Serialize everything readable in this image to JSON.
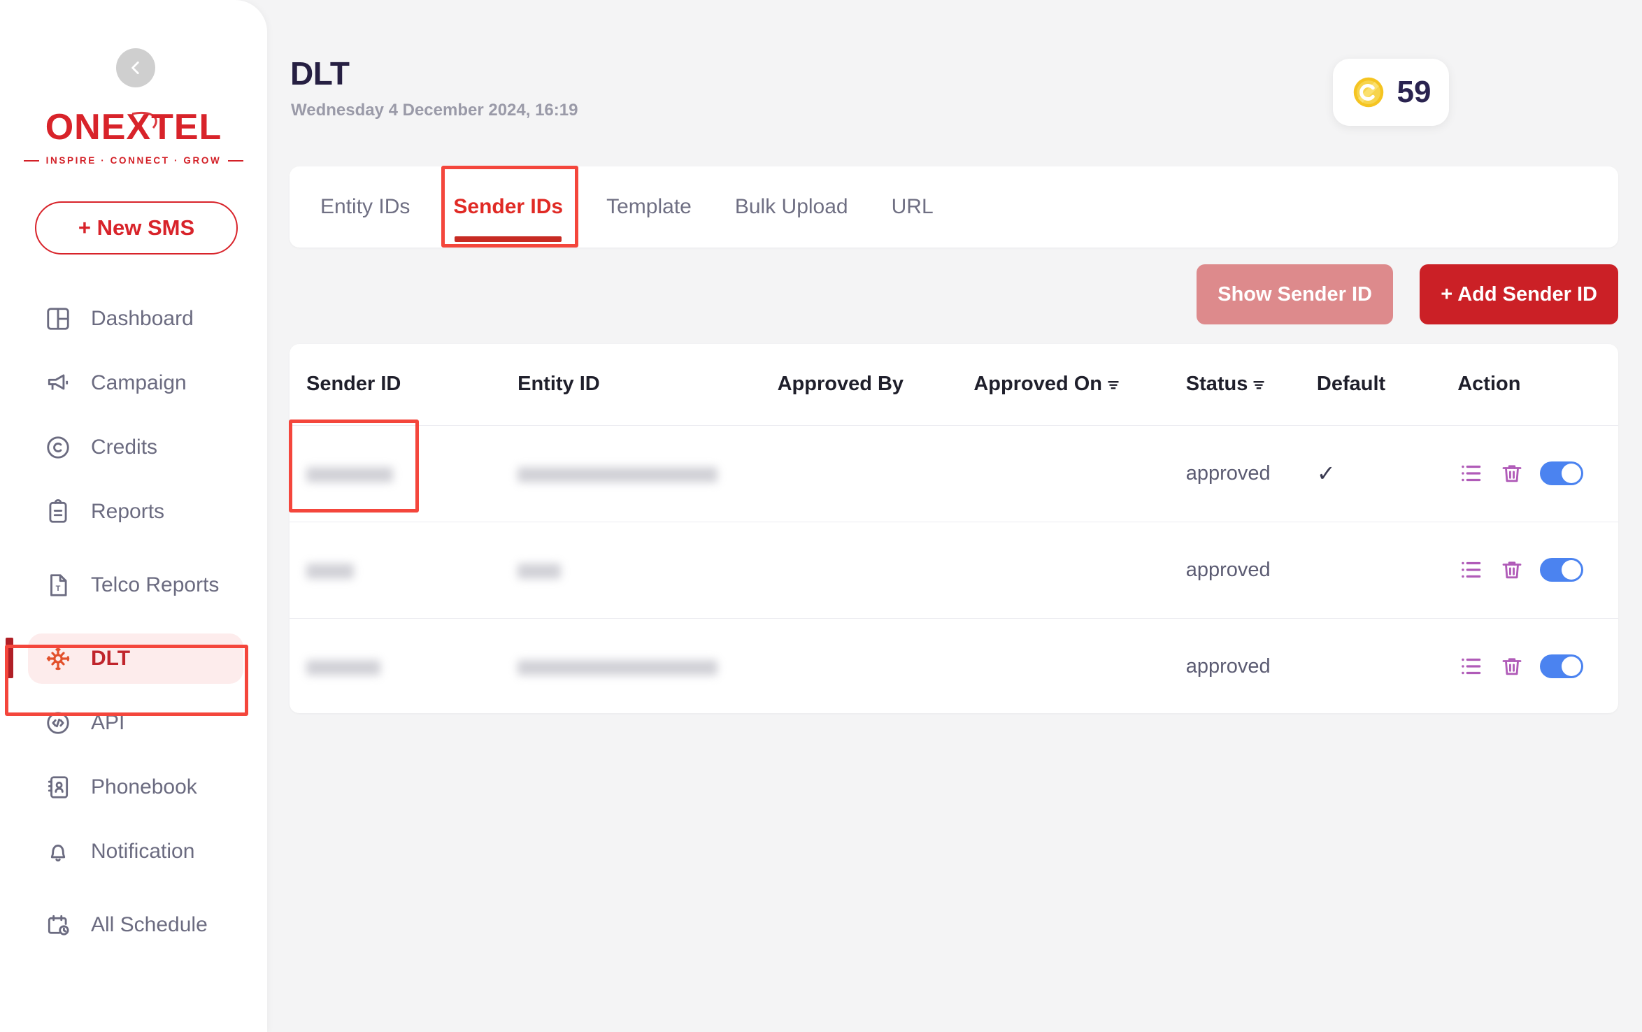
{
  "brand": {
    "logo_text": "ONEXTEL",
    "tagline": "INSPIRE · CONNECT · GROW",
    "accent": "#d8232a"
  },
  "sidebar": {
    "collapse_icon": "chevron-left-icon",
    "new_sms_label": "+ New SMS",
    "items": [
      {
        "label": "Dashboard",
        "icon": "dashboard-icon",
        "active": false
      },
      {
        "label": "Campaign",
        "icon": "megaphone-icon",
        "active": false
      },
      {
        "label": "Credits",
        "icon": "credits-coin-icon",
        "active": false
      },
      {
        "label": "Reports",
        "icon": "clipboard-icon",
        "active": false
      },
      {
        "label": "Telco Reports",
        "icon": "telco-doc-icon",
        "active": false
      },
      {
        "label": "DLT",
        "icon": "dlt-network-icon",
        "active": true
      },
      {
        "label": "API",
        "icon": "code-icon",
        "active": false
      },
      {
        "label": "Phonebook",
        "icon": "contact-book-icon",
        "active": false
      },
      {
        "label": "Notification",
        "icon": "bell-icon",
        "active": false
      },
      {
        "label": "All Schedule",
        "icon": "calendar-clock-icon",
        "active": false
      }
    ]
  },
  "header": {
    "title": "DLT",
    "date": "Wednesday 4 December 2024, 16:19",
    "credits": {
      "icon": "gold-coin-icon",
      "value": "59"
    }
  },
  "tabs": [
    {
      "label": "Entity IDs",
      "active": false
    },
    {
      "label": "Sender IDs",
      "active": true
    },
    {
      "label": "Template",
      "active": false
    },
    {
      "label": "Bulk Upload",
      "active": false
    },
    {
      "label": "URL",
      "active": false
    }
  ],
  "toolbar": {
    "show_sender_id_label": "Show Sender ID",
    "add_sender_id_label": "+ Add Sender ID"
  },
  "table": {
    "columns": [
      {
        "label": "Sender ID",
        "sortable": false
      },
      {
        "label": "Entity ID",
        "sortable": false
      },
      {
        "label": "Approved By",
        "sortable": false
      },
      {
        "label": "Approved On",
        "sortable": true
      },
      {
        "label": "Status",
        "sortable": true
      },
      {
        "label": "Default",
        "sortable": false
      },
      {
        "label": "Action",
        "sortable": false
      }
    ],
    "rows": [
      {
        "sender_id": "",
        "sender_id_redacted": true,
        "sender_id_width": 124,
        "entity_id": "",
        "entity_id_redacted": true,
        "entity_id_width": 286,
        "approved_by": "",
        "approved_on": "",
        "status": "approved",
        "default": true,
        "actions": [
          "list-icon",
          "trash-icon",
          "toggle-switch"
        ],
        "toggle_on": true
      },
      {
        "sender_id": "",
        "sender_id_redacted": true,
        "sender_id_width": 68,
        "entity_id": "",
        "entity_id_redacted": true,
        "entity_id_width": 62,
        "approved_by": "",
        "approved_on": "",
        "status": "approved",
        "default": false,
        "actions": [
          "list-icon",
          "trash-icon",
          "toggle-switch"
        ],
        "toggle_on": true
      },
      {
        "sender_id": "",
        "sender_id_redacted": true,
        "sender_id_width": 106,
        "entity_id": "",
        "entity_id_redacted": true,
        "entity_id_width": 286,
        "approved_by": "",
        "approved_on": "",
        "status": "approved",
        "default": false,
        "actions": [
          "list-icon",
          "trash-icon",
          "toggle-switch"
        ],
        "toggle_on": true
      }
    ],
    "default_check_glyph": "✓"
  },
  "annotations": [
    {
      "name": "annotation-dlt-nav",
      "color": "#f4463c"
    },
    {
      "name": "annotation-sender-tab",
      "color": "#f4463c"
    },
    {
      "name": "annotation-sender-cell",
      "color": "#f4463c"
    }
  ]
}
